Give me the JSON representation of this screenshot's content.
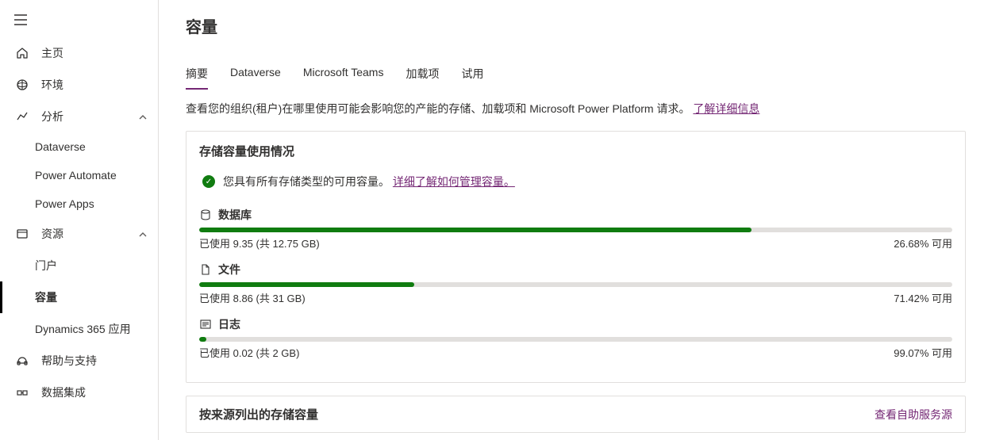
{
  "sidebar": {
    "items": [
      {
        "icon": "home",
        "label": "主页"
      },
      {
        "icon": "env",
        "label": "环境"
      },
      {
        "icon": "analytics",
        "label": "分析",
        "expandable": true
      },
      {
        "icon": "",
        "label": "Dataverse",
        "sub": true
      },
      {
        "icon": "",
        "label": "Power Automate",
        "sub": true
      },
      {
        "icon": "",
        "label": "Power Apps",
        "sub": true
      },
      {
        "icon": "resource",
        "label": "资源",
        "expandable": true
      },
      {
        "icon": "",
        "label": "门户",
        "sub": true
      },
      {
        "icon": "",
        "label": "容量",
        "sub": true,
        "active": true
      },
      {
        "icon": "",
        "label": "Dynamics 365 应用",
        "sub": true
      },
      {
        "icon": "help",
        "label": "帮助与支持"
      },
      {
        "icon": "integration",
        "label": "数据集成"
      }
    ]
  },
  "page": {
    "title": "容量",
    "tabs": [
      {
        "label": "摘要",
        "active": true
      },
      {
        "label": "Dataverse"
      },
      {
        "label": "Microsoft Teams"
      },
      {
        "label": "加载项"
      },
      {
        "label": "试用"
      }
    ],
    "description_prefix": "查看您的组织(租户)在哪里使用可能会影响您的产能的存储、加载项和 Microsoft Power Platform 请求。",
    "description_link": "了解详细信息"
  },
  "storage_card": {
    "title": "存储容量使用情况",
    "status_text": "您具有所有存储类型的可用容量。",
    "status_link": "详细了解如何管理容量。",
    "items": [
      {
        "icon": "db",
        "name": "数据库",
        "used": "已使用 9.35 (共 12.75 GB)",
        "available": "26.68% 可用",
        "fillPercent": 73.32
      },
      {
        "icon": "file",
        "name": "文件",
        "used": "已使用 8.86 (共 31 GB)",
        "available": "71.42% 可用",
        "fillPercent": 28.58
      },
      {
        "icon": "log",
        "name": "日志",
        "used": "已使用 0.02 (共 2 GB)",
        "available": "99.07% 可用",
        "fillPercent": 1.0
      }
    ]
  },
  "source_card": {
    "title": "按来源列出的存储容量",
    "link": "查看自助服务源"
  },
  "chart_data": [
    {
      "type": "bar",
      "title": "数据库",
      "categories": [
        "已使用"
      ],
      "values": [
        9.35
      ],
      "ylim": [
        0,
        12.75
      ],
      "ylabel": "GB",
      "available_percent": 26.68
    },
    {
      "type": "bar",
      "title": "文件",
      "categories": [
        "已使用"
      ],
      "values": [
        8.86
      ],
      "ylim": [
        0,
        31
      ],
      "ylabel": "GB",
      "available_percent": 71.42
    },
    {
      "type": "bar",
      "title": "日志",
      "categories": [
        "已使用"
      ],
      "values": [
        0.02
      ],
      "ylim": [
        0,
        2
      ],
      "ylabel": "GB",
      "available_percent": 99.07
    }
  ]
}
